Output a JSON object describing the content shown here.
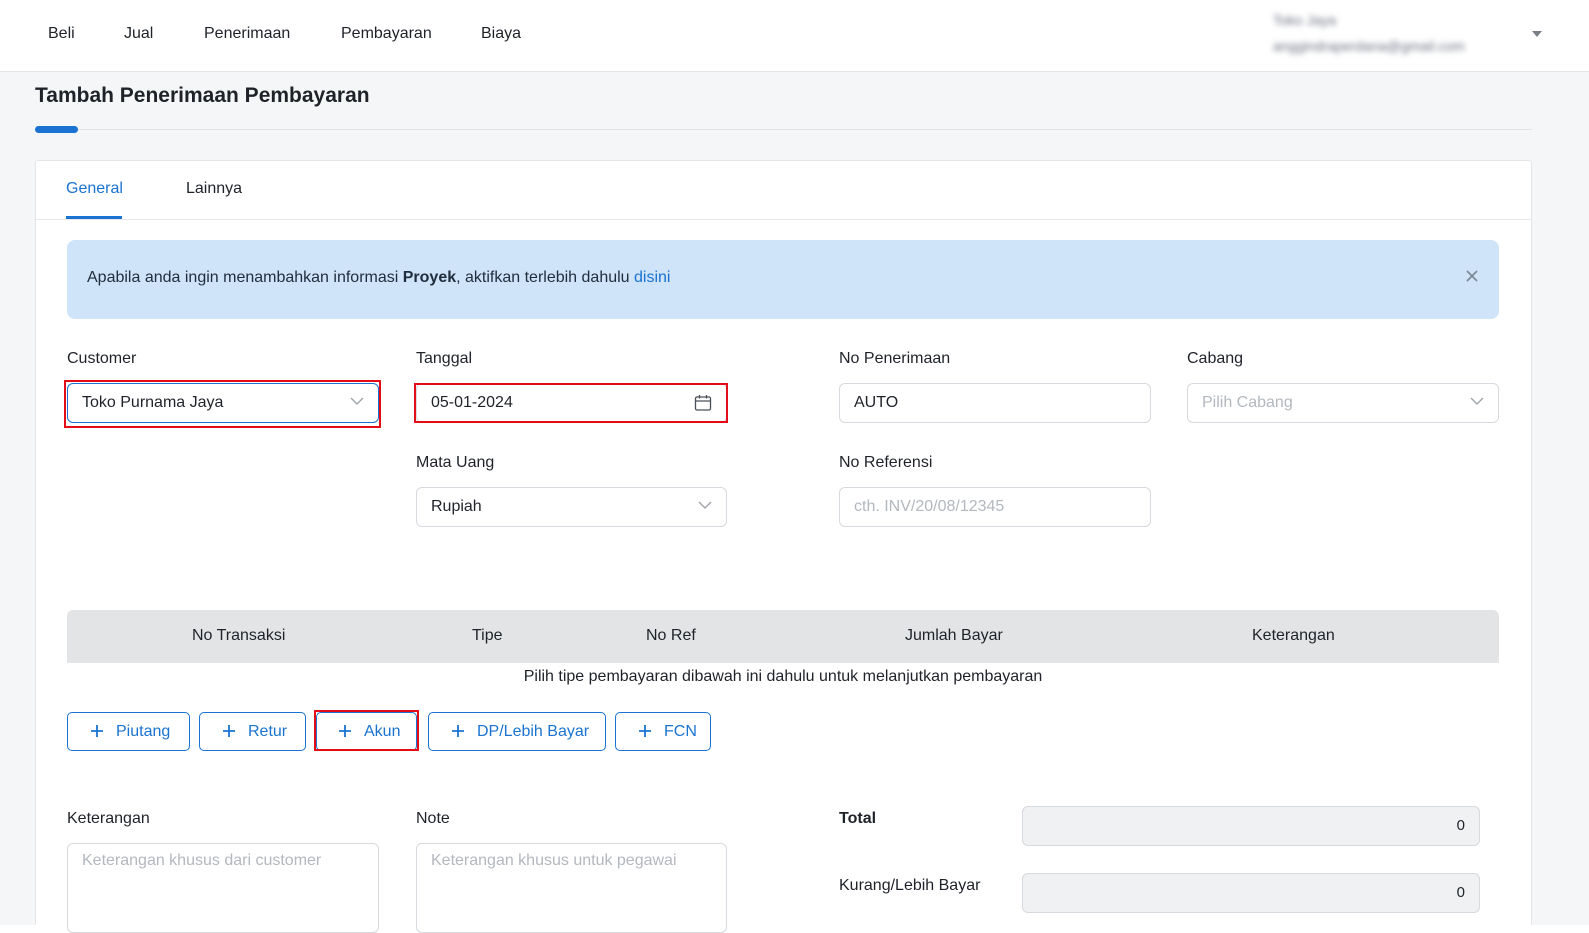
{
  "nav": {
    "items": [
      {
        "label": "Beli"
      },
      {
        "label": "Jual"
      },
      {
        "label": "Penerimaan"
      },
      {
        "label": "Pembayaran"
      },
      {
        "label": "Biaya"
      }
    ],
    "user_name": "Toko Jaya",
    "user_email": "anggindraperdana@gmail.com"
  },
  "page": {
    "title": "Tambah Penerimaan Pembayaran"
  },
  "tabs": [
    {
      "label": "General",
      "active": true
    },
    {
      "label": "Lainnya",
      "active": false
    }
  ],
  "alert": {
    "prefix": "Apabila anda ingin menambahkan informasi ",
    "bold": "Proyek",
    "middle": ", aktifkan terlebih dahulu ",
    "link": "disini"
  },
  "form": {
    "customer_label": "Customer",
    "customer_value": "Toko Purnama Jaya",
    "tanggal_label": "Tanggal",
    "tanggal_value": "05-01-2024",
    "no_penerimaan_label": "No Penerimaan",
    "no_penerimaan_value": "AUTO",
    "cabang_label": "Cabang",
    "cabang_placeholder": "Pilih Cabang",
    "mata_uang_label": "Mata Uang",
    "mata_uang_value": "Rupiah",
    "no_referensi_label": "No Referensi",
    "no_referensi_placeholder": "cth. INV/20/08/12345"
  },
  "table": {
    "headers": [
      "No Transaksi",
      "Tipe",
      "No Ref",
      "Jumlah Bayar",
      "Keterangan"
    ],
    "empty_message": "Pilih tipe pembayaran dibawah ini dahulu untuk melanjutkan pembayaran"
  },
  "buttons": [
    {
      "label": "Piutang"
    },
    {
      "label": "Retur"
    },
    {
      "label": "Akun"
    },
    {
      "label": "DP/Lebih Bayar"
    },
    {
      "label": "FCN"
    }
  ],
  "footer": {
    "keterangan_label": "Keterangan",
    "keterangan_placeholder": "Keterangan khusus dari customer",
    "note_label": "Note",
    "note_placeholder": "Keterangan khusus untuk pegawai",
    "total_label": "Total",
    "total_value": "0",
    "kurang_label": "Kurang/Lebih Bayar",
    "kurang_value": "0"
  },
  "colors": {
    "accent": "#1a73d1",
    "highlight": "#e30c17",
    "alert_bg": "#cfe3f9"
  }
}
